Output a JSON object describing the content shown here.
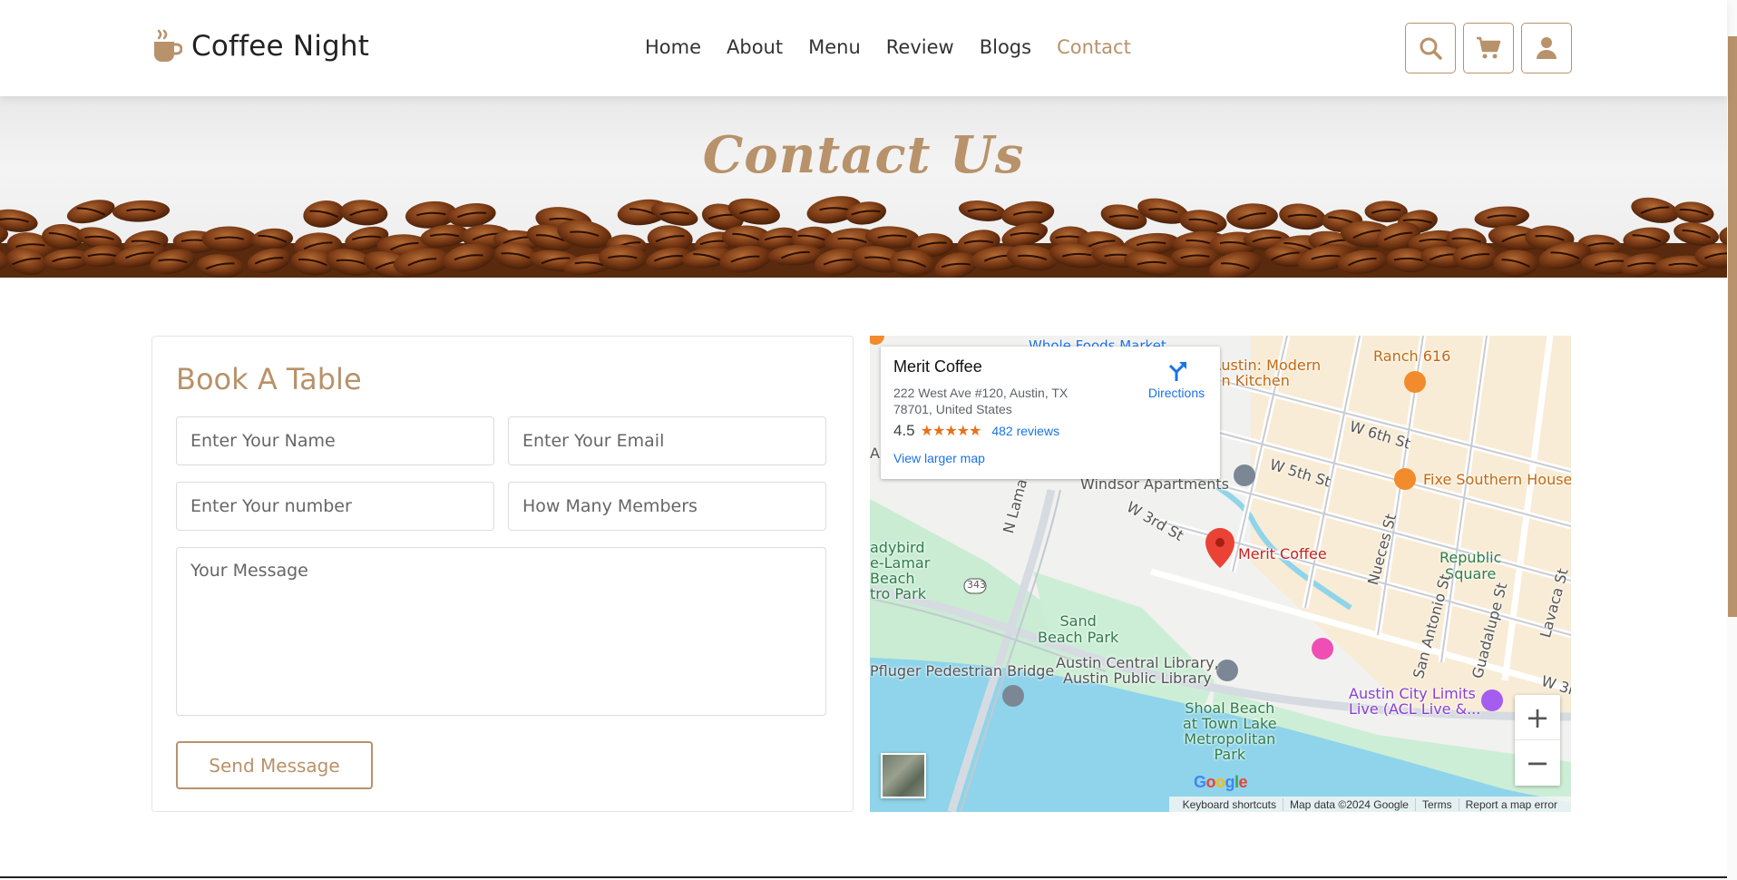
{
  "header": {
    "brand": "Coffee Night",
    "nav": [
      {
        "label": "Home",
        "active": false
      },
      {
        "label": "About",
        "active": false
      },
      {
        "label": "Menu",
        "active": false
      },
      {
        "label": "Review",
        "active": false
      },
      {
        "label": "Blogs",
        "active": false
      },
      {
        "label": "Contact",
        "active": true
      }
    ],
    "icons": [
      "search-icon",
      "cart-icon",
      "user-icon"
    ]
  },
  "banner": {
    "title": "Contact Us"
  },
  "form": {
    "title": "Book A Table",
    "name_placeholder": "Enter Your Name",
    "email_placeholder": "Enter Your Email",
    "number_placeholder": "Enter Your number",
    "members_placeholder": "How Many Members",
    "message_placeholder": "Your Message",
    "submit_label": "Send Message"
  },
  "map": {
    "place_name": "Merit Coffee",
    "address": "222 West Ave #120, Austin, TX 78701, United States",
    "rating": "4.5",
    "stars": "★★★★★",
    "reviews": "482 reviews",
    "larger_map": "View larger map",
    "directions": "Directions",
    "labels": {
      "whole_foods": "Whole Foods Market",
      "qi_austin": "QI Austin: Modern\nAsian Kitchen",
      "ranch616": "Ranch 616",
      "w6th": "W 6th St",
      "w5th": "W 5th St",
      "w3rd": "W 3rd St",
      "w3rd_right": "W 3r",
      "windsor": "Windsor Apartments",
      "fixe": "Fixe Southern House",
      "merit_pin": "Merit Coffee",
      "republic": "Republic\nSquare",
      "n_lamar": "N Lamar Blvd",
      "nueces": "Nueces St",
      "san_antonio": "San Antonio St",
      "guadalupe": "Guadalupe St",
      "lavaca": "Lavaca St",
      "ladybird": "adybird\ne-Lamar\nBeach\ntro Park",
      "sand_beach": "Sand\nBeach Park",
      "route343": "343",
      "pfluger": "Pfluger Pedestrian Bridge",
      "library": "Austin Central Library,\nAustin Public Library",
      "shoal": "Shoal Beach\nat Town Lake\nMetropolitan\nPark",
      "acl": "Austin City Limits\nLive (ACL Live &...",
      "au": "Au"
    },
    "google": "Google",
    "footer": [
      "Keyboard shortcuts",
      "Map data ©2024 Google",
      "Terms",
      "Report a map error"
    ],
    "zoom_in": "+",
    "zoom_out": "−"
  },
  "colors": {
    "accent": "#b8926a",
    "text": "#333333"
  }
}
